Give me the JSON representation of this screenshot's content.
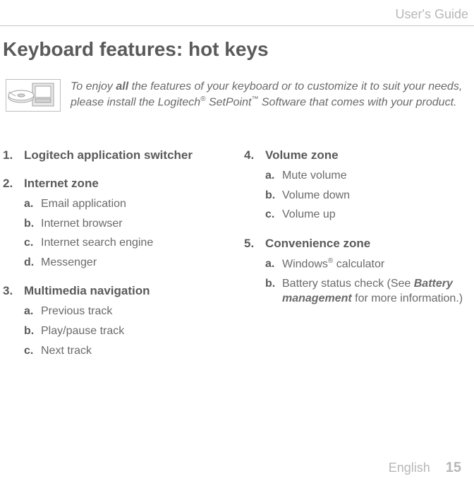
{
  "header": {
    "guide_label": "User's Guide"
  },
  "title": "Keyboard features: hot keys",
  "intro": {
    "pre": "To enjoy ",
    "strong": "all",
    "post1": " the features of your keyboard or to customize it to suit your needs, please install the Logitech",
    "reg": "®",
    "post2": " SetPoint",
    "tm": "™",
    "post3": " Software that comes with your product."
  },
  "left_sections": [
    {
      "num": "1.",
      "title": "Logitech application switcher",
      "items": []
    },
    {
      "num": "2.",
      "title": "Internet zone",
      "items": [
        {
          "letter": "a.",
          "text": "Email application"
        },
        {
          "letter": "b.",
          "text": "Internet browser"
        },
        {
          "letter": "c.",
          "text": "Internet search engine"
        },
        {
          "letter": "d.",
          "text": "Messenger"
        }
      ]
    },
    {
      "num": "3.",
      "title": "Multimedia navigation",
      "items": [
        {
          "letter": "a.",
          "text": "Previous track"
        },
        {
          "letter": "b.",
          "text": "Play/pause track"
        },
        {
          "letter": "c.",
          "text": "Next track"
        }
      ]
    }
  ],
  "right_sections": [
    {
      "num": "4.",
      "title": "Volume zone",
      "items": [
        {
          "letter": "a.",
          "text": "Mute volume"
        },
        {
          "letter": "b.",
          "text": "Volume down"
        },
        {
          "letter": "c.",
          "text": "Volume up"
        }
      ]
    },
    {
      "num": "5.",
      "title": "Convenience zone",
      "items": [
        {
          "letter": "a.",
          "text_pre": "Windows",
          "sup": "®",
          "text_post": " calculator"
        },
        {
          "letter": "b.",
          "text_pre": "Battery status check (See ",
          "em_strong": "Battery management",
          "text_post": " for more information.)"
        }
      ]
    }
  ],
  "footer": {
    "language": "English",
    "page": "15"
  }
}
